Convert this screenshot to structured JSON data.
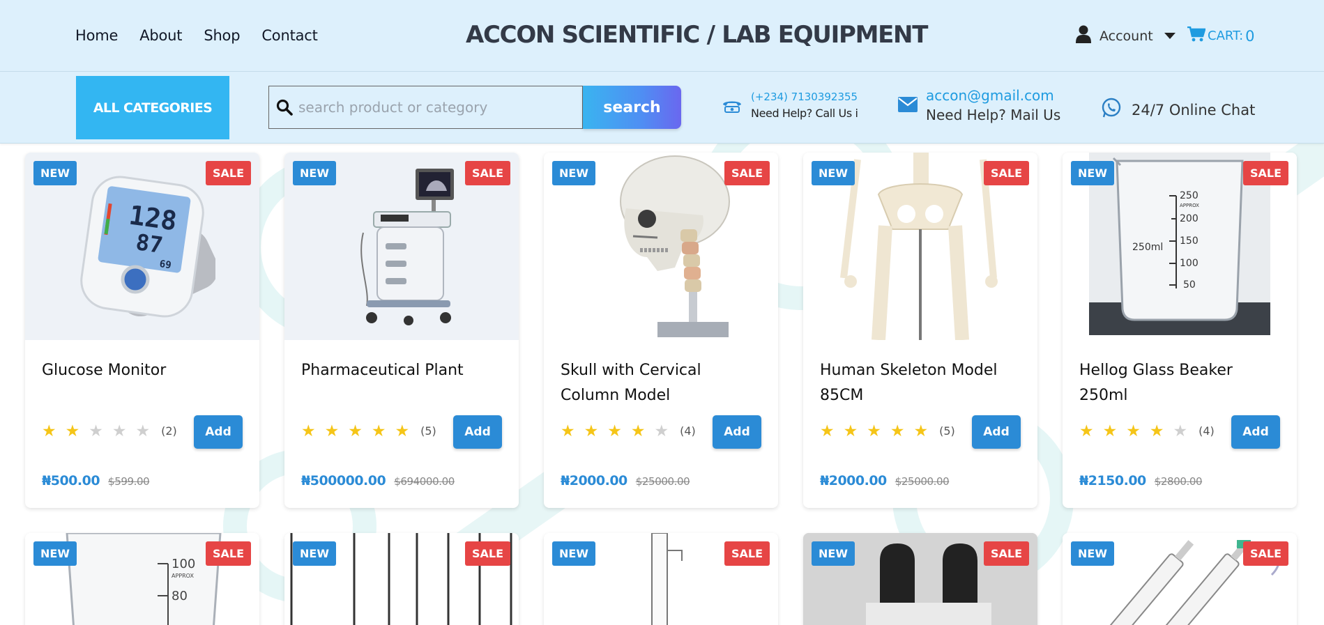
{
  "nav": {
    "links": [
      "Home",
      "About",
      "Shop",
      "Contact"
    ],
    "brand": "ACCON SCIENTIFIC / LAB EQUIPMENT",
    "account_label": "Account",
    "cart_label": "CART:",
    "cart_count": "0"
  },
  "subbar": {
    "all_categories": "ALL CATEGORIES",
    "search_placeholder": "search product or category",
    "search_button": "search",
    "phone": "(+234) 7130392355",
    "call_text": "Need Help? Call Us i",
    "email": "accon@gmail.com",
    "mail_text": "Need Help? Mail Us",
    "chat_text": "24/7 Online Chat"
  },
  "badges": {
    "new": "NEW",
    "sale": "SALE"
  },
  "add_label": "Add",
  "products": [
    {
      "name": "Glucose Monitor",
      "rating": 2,
      "reviews": "(2)",
      "price": "₦500.00",
      "old_price": "$599.00",
      "image": "bp-monitor"
    },
    {
      "name": "Pharmaceutical Plant",
      "rating": 5,
      "reviews": "(5)",
      "price": "₦500000.00",
      "old_price": "$694000.00",
      "image": "ultrasound-cart"
    },
    {
      "name": "Skull with Cervical Column Model",
      "rating": 4,
      "reviews": "(4)",
      "price": "₦2000.00",
      "old_price": "$25000.00",
      "image": "skull-model"
    },
    {
      "name": "Human Skeleton Model 85CM",
      "rating": 5,
      "reviews": "(5)",
      "price": "₦2000.00",
      "old_price": "$25000.00",
      "image": "skeleton-model"
    },
    {
      "name": "Hellog Glass Beaker 250ml",
      "rating": 4,
      "reviews": "(4)",
      "price": "₦2150.00",
      "old_price": "$2800.00",
      "image": "glass-beaker"
    }
  ],
  "second_row_images": [
    "beaker-closeup",
    "test-tubes",
    "glass-column",
    "dark-bottles",
    "syringes"
  ],
  "beaker_marks": [
    "250",
    "APPROX",
    "200",
    "150",
    "100",
    "50",
    "250ml"
  ],
  "beaker2_marks": [
    "100",
    "APPROX",
    "80"
  ],
  "bp_display": [
    "128",
    "87",
    "69"
  ]
}
